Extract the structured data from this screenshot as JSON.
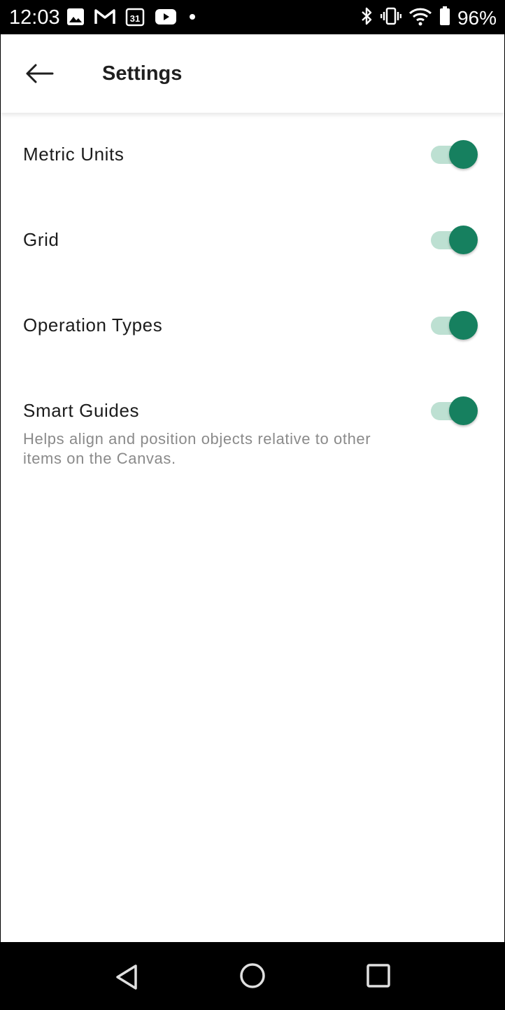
{
  "status_bar": {
    "time": "12:03",
    "battery_percent": "96%",
    "left_icons": [
      "image-icon",
      "gmail-icon",
      "calendar-icon",
      "youtube-icon",
      "dot-icon"
    ],
    "calendar_day": "31",
    "right_icons": [
      "bluetooth-icon",
      "vibrate-icon",
      "wifi-icon",
      "battery-icon"
    ]
  },
  "app_bar": {
    "title": "Settings",
    "back_icon": "arrow-left-icon"
  },
  "settings": [
    {
      "label": "Metric Units",
      "enabled": true,
      "description": ""
    },
    {
      "label": "Grid",
      "enabled": true,
      "description": ""
    },
    {
      "label": "Operation Types",
      "enabled": true,
      "description": ""
    },
    {
      "label": "Smart Guides",
      "enabled": true,
      "description": "Helps align and position objects relative to other items on the Canvas."
    }
  ],
  "colors": {
    "toggle_thumb_on": "#16805f",
    "toggle_track_on": "#bde0d2",
    "title_text": "#1f1f1f",
    "description_text": "#8a8a8a"
  },
  "nav_bar": {
    "icons": [
      "back-triangle-icon",
      "home-circle-icon",
      "recents-square-icon"
    ]
  }
}
